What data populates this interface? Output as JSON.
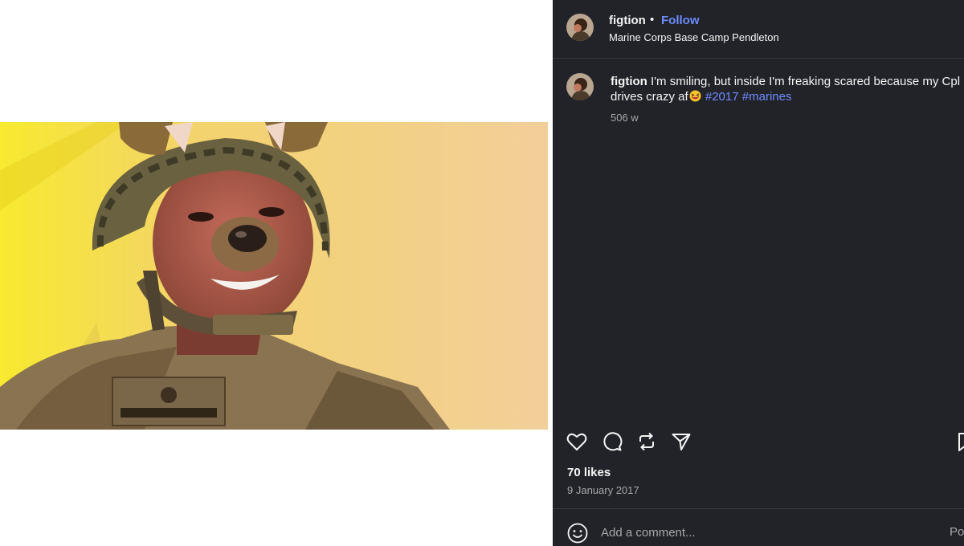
{
  "post": {
    "username": "figtion",
    "separator": "•",
    "follow_label": "Follow",
    "location": "Marine Corps Base Camp Pendleton",
    "caption_line1": "I'm smiling, but inside I'm freaking scared because my Cpl",
    "caption_line2": "drives crazy af",
    "hashtags": [
      "#2017",
      "#marines"
    ],
    "time_ago": "506 w",
    "likes": "70 likes",
    "date": "9 January 2017"
  },
  "actions": {
    "icons": [
      "heart-icon",
      "comment-icon",
      "repost-icon",
      "share-icon",
      "bookmark-icon"
    ]
  },
  "comment": {
    "placeholder": "Add a comment...",
    "post_label": "Post"
  },
  "colors": {
    "panel_bg": "#212328",
    "link_blue": "#6e8cff",
    "muted_text": "#a8a8a8"
  }
}
